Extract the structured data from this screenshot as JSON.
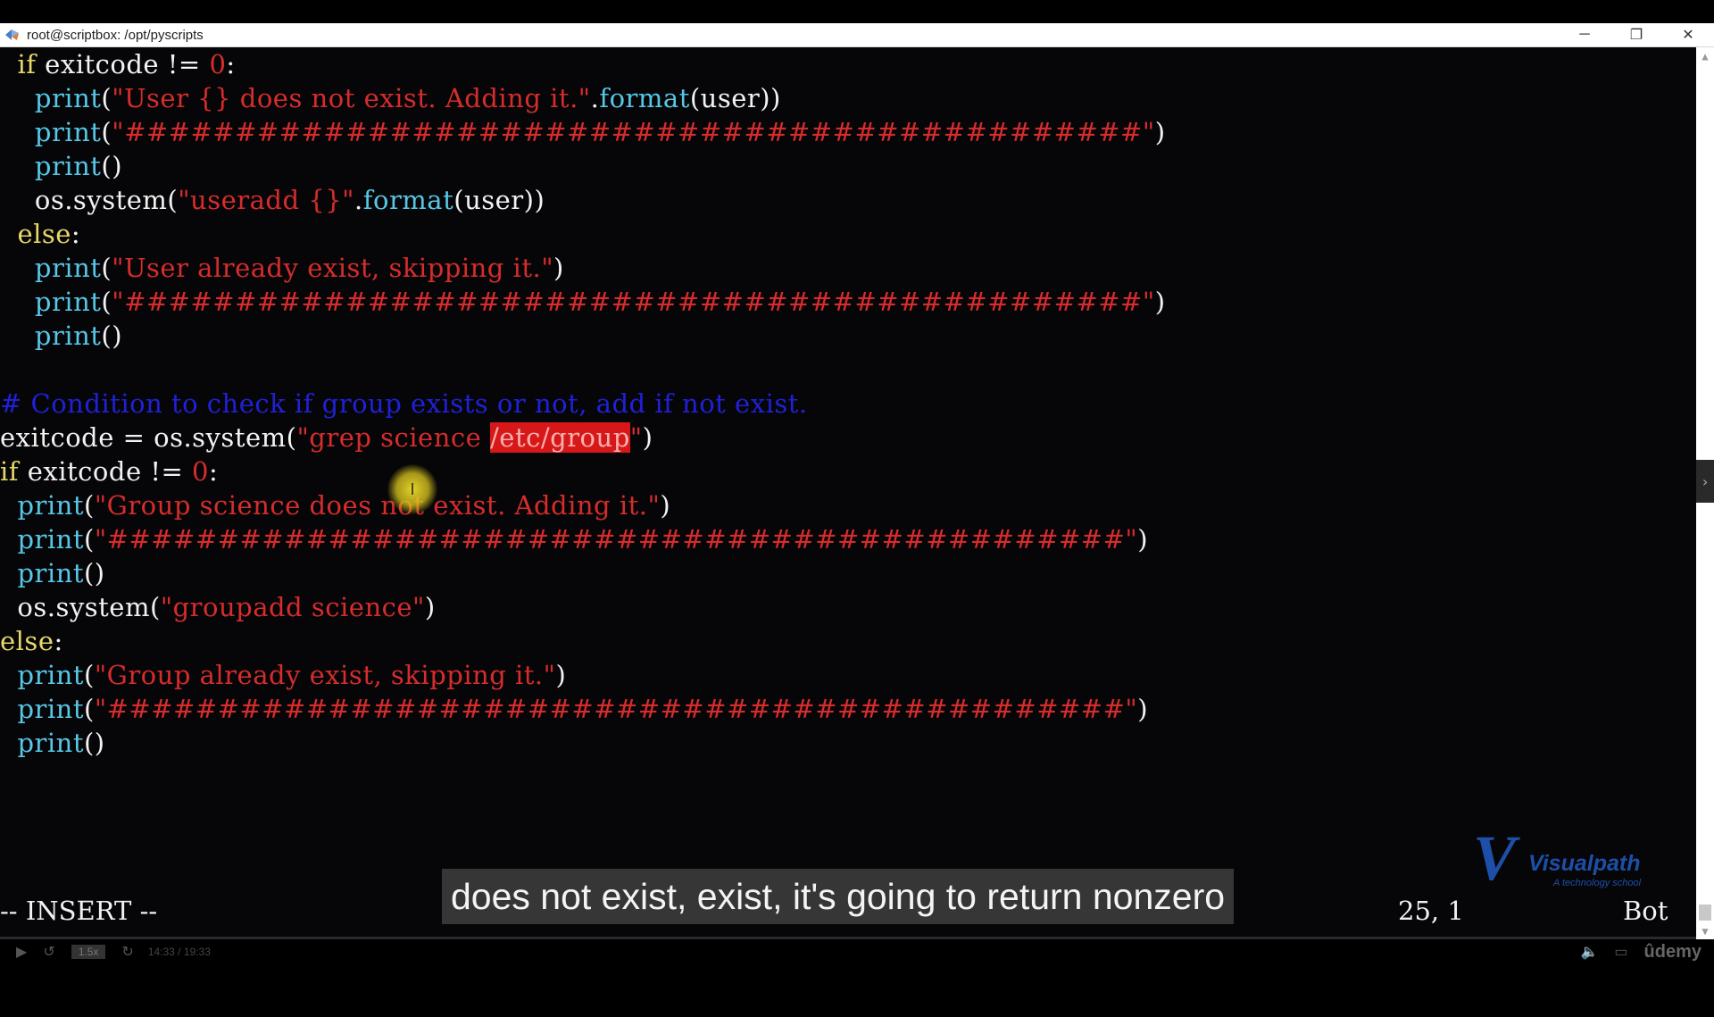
{
  "window": {
    "title": "root@scriptbox: /opt/pyscripts",
    "minimize": "─",
    "restore": "❐",
    "close": "✕"
  },
  "code_lines": [
    [
      {
        "t": "  "
      },
      {
        "t": "if",
        "c": "kw"
      },
      {
        "t": " exitcode != "
      },
      {
        "t": "0",
        "c": "num"
      },
      {
        "t": ":"
      }
    ],
    [
      {
        "t": "    "
      },
      {
        "t": "print",
        "c": "fn"
      },
      {
        "t": "("
      },
      {
        "t": "\"User {} does not exist. Adding it.\"",
        "c": "str"
      },
      {
        "t": "."
      },
      {
        "t": "format",
        "c": "fn"
      },
      {
        "t": "(user))"
      }
    ],
    [
      {
        "t": "    "
      },
      {
        "t": "print",
        "c": "fn"
      },
      {
        "t": "("
      },
      {
        "t": "\"##############################################\"",
        "c": "str"
      },
      {
        "t": ")"
      }
    ],
    [
      {
        "t": "    "
      },
      {
        "t": "print",
        "c": "fn"
      },
      {
        "t": "()"
      }
    ],
    [
      {
        "t": "    os.system("
      },
      {
        "t": "\"useradd {}\"",
        "c": "str"
      },
      {
        "t": "."
      },
      {
        "t": "format",
        "c": "fn"
      },
      {
        "t": "(user))"
      }
    ],
    [
      {
        "t": "  "
      },
      {
        "t": "else",
        "c": "kw"
      },
      {
        "t": ":"
      }
    ],
    [
      {
        "t": "    "
      },
      {
        "t": "print",
        "c": "fn"
      },
      {
        "t": "("
      },
      {
        "t": "\"User already exist, skipping it.\"",
        "c": "str"
      },
      {
        "t": ")"
      }
    ],
    [
      {
        "t": "    "
      },
      {
        "t": "print",
        "c": "fn"
      },
      {
        "t": "("
      },
      {
        "t": "\"##############################################\"",
        "c": "str"
      },
      {
        "t": ")"
      }
    ],
    [
      {
        "t": "    "
      },
      {
        "t": "print",
        "c": "fn"
      },
      {
        "t": "()"
      }
    ],
    [
      {
        "t": ""
      }
    ],
    [
      {
        "t": "# Condition to check if group exists or not, add if not exist.",
        "c": "cm"
      }
    ],
    [
      {
        "t": "exitcode = os.system("
      },
      {
        "t": "\"grep science ",
        "c": "str"
      },
      {
        "t": "/etc/group",
        "c": "hl"
      },
      {
        "t": "\"",
        "c": "str"
      },
      {
        "t": ")"
      }
    ],
    [
      {
        "t": "if",
        "c": "kw"
      },
      {
        "t": " exitcode != "
      },
      {
        "t": "0",
        "c": "num"
      },
      {
        "t": ":"
      }
    ],
    [
      {
        "t": "  "
      },
      {
        "t": "print",
        "c": "fn"
      },
      {
        "t": "("
      },
      {
        "t": "\"Group science does not exist. Adding it.\"",
        "c": "str"
      },
      {
        "t": ")"
      }
    ],
    [
      {
        "t": "  "
      },
      {
        "t": "print",
        "c": "fn"
      },
      {
        "t": "("
      },
      {
        "t": "\"##############################################\"",
        "c": "str"
      },
      {
        "t": ")"
      }
    ],
    [
      {
        "t": "  "
      },
      {
        "t": "print",
        "c": "fn"
      },
      {
        "t": "()"
      }
    ],
    [
      {
        "t": "  os.system("
      },
      {
        "t": "\"groupadd science\"",
        "c": "str"
      },
      {
        "t": ")"
      }
    ],
    [
      {
        "t": "else",
        "c": "kw"
      },
      {
        "t": ":"
      }
    ],
    [
      {
        "t": "  "
      },
      {
        "t": "print",
        "c": "fn"
      },
      {
        "t": "("
      },
      {
        "t": "\"Group already exist, skipping it.\"",
        "c": "str"
      },
      {
        "t": ")"
      }
    ],
    [
      {
        "t": "  "
      },
      {
        "t": "print",
        "c": "fn"
      },
      {
        "t": "("
      },
      {
        "t": "\"##############################################\"",
        "c": "str"
      },
      {
        "t": ")"
      }
    ],
    [
      {
        "t": "  "
      },
      {
        "t": "print",
        "c": "fn"
      },
      {
        "t": "()"
      }
    ]
  ],
  "status": {
    "mode": "-- INSERT --",
    "position": "25, 1",
    "scroll": "Bot"
  },
  "subtitle": "does not exist, exist, it's going to return nonzero",
  "watermark": {
    "letter": "V",
    "name": "Visualpath",
    "tagline": "A technology school"
  },
  "cursor_glyph": "I",
  "player": {
    "speed": "1.5x",
    "time": "14:33 / 19:33",
    "brand": "ûdemy"
  },
  "colors": {
    "keyword": "#e6d86b",
    "function": "#57c7e6",
    "string": "#d62c2c",
    "comment": "#2020d8",
    "search_highlight": "#d81818"
  }
}
